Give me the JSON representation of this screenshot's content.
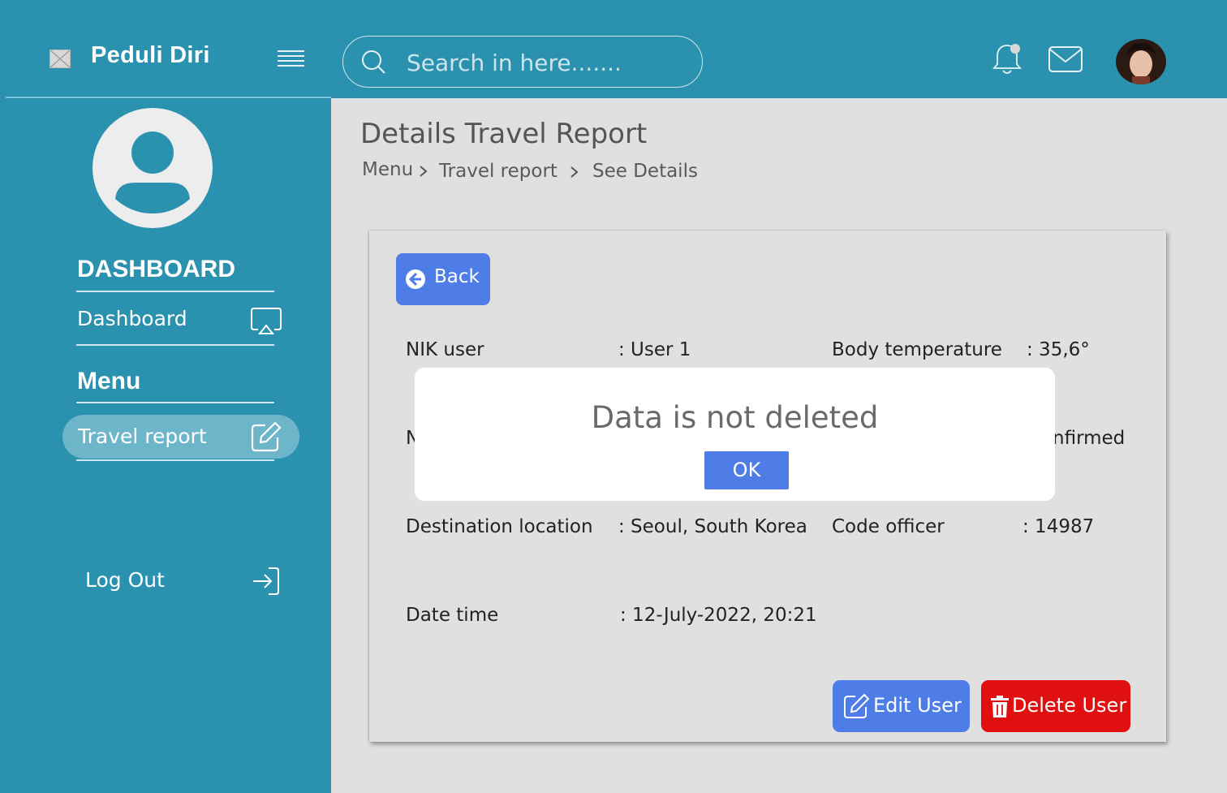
{
  "header": {
    "brand": "Peduli Diri",
    "search_placeholder": "Search in here......."
  },
  "sidebar": {
    "dashboard_title": "DASHBOARD",
    "dashboard_item": "Dashboard",
    "menu_title": "Menu",
    "travel_item": "Travel report",
    "logout": "Log Out"
  },
  "page": {
    "title": "Details Travel Report",
    "breadcrumb": [
      "Menu",
      "Travel report",
      "See Details"
    ]
  },
  "card": {
    "back_label": "Back",
    "fields": {
      "nik_label": "NIK user",
      "nik_value": ":   User 1",
      "temp_label": "Body temperature",
      "temp_value": ": 35,6°",
      "partial_left": "N",
      "partial_right": "nfirmed",
      "dest_label": "Destination location",
      "dest_value": ": Seoul, South Korea",
      "code_label": "Code officer",
      "code_value": ": 14987",
      "date_label": "Date time",
      "date_value": ": 12-July-2022, 20:21"
    },
    "edit_label": "Edit User",
    "delete_label": "Delete User"
  },
  "modal": {
    "message": "Data is not deleted",
    "ok_label": "OK"
  },
  "colors": {
    "primary": "#2a92ae",
    "button_blue": "#4e7de8",
    "danger": "#e01010"
  }
}
